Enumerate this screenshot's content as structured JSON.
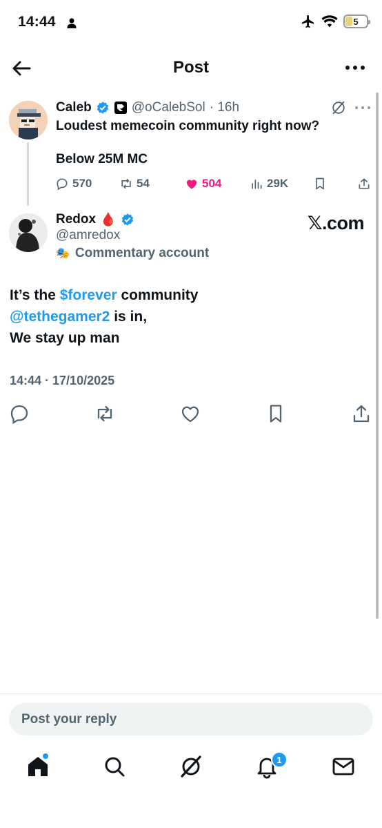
{
  "status_bar": {
    "time": "14:44",
    "battery": "5"
  },
  "header": {
    "title": "Post"
  },
  "quoted_post": {
    "name": "Caleb",
    "handle": "@oCalebSol",
    "time": "· 16h",
    "line1": "Loudest memecoin community right now?",
    "line2": "Below 25M MC",
    "replies": "570",
    "reposts": "54",
    "likes": "504",
    "views": "29K",
    "like_color": "#f91880"
  },
  "main_post": {
    "name": "Redox",
    "name_emoji": "🩸",
    "handle": "@amredox",
    "label_icon": "🎭",
    "label": "Commentary account",
    "watermark": "𝕏.com",
    "text_part1": "It’s the ",
    "cashtag": "$forever",
    "text_part2": " community",
    "mention": "@tethegamer2",
    "text_part3": " is in,",
    "text_line3": "We stay up man",
    "timestamp": "14:44 · 17/10/2025"
  },
  "reply": {
    "placeholder": "Post your reply"
  },
  "tabbar": {
    "notifications_badge": "1"
  },
  "colors": {
    "accent": "#1d9bf0",
    "text": "#0f1419",
    "muted": "#536471"
  }
}
